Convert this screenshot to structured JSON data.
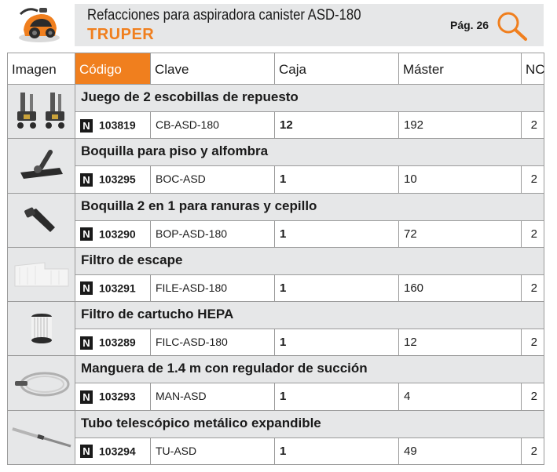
{
  "header": {
    "title": "Refacciones para aspiradora canister ASD-180",
    "brand": "TRUPER",
    "page": "Pág. 26",
    "search_icon": "magnifier-icon",
    "accent_color": "#f07f1e"
  },
  "columns": [
    "Imagen",
    "Código",
    "Clave",
    "Caja",
    "Máster",
    "NC"
  ],
  "products": [
    {
      "name": "Juego de 2 escobillas de repuesto",
      "badge": "N",
      "code": "103819",
      "clave": "CB-ASD-180",
      "caja": "12",
      "master": "192",
      "nc": "2",
      "image": "brushes-image"
    },
    {
      "name": "Boquilla para piso y alfombra",
      "badge": "N",
      "code": "103295",
      "clave": "BOC-ASD",
      "caja": "1",
      "master": "10",
      "nc": "2",
      "image": "floor-nozzle-image"
    },
    {
      "name": "Boquilla 2 en 1 para ranuras y cepillo",
      "badge": "N",
      "code": "103290",
      "clave": "BOP-ASD-180",
      "caja": "1",
      "master": "72",
      "nc": "2",
      "image": "crevice-nozzle-image"
    },
    {
      "name": "Filtro de escape",
      "badge": "N",
      "code": "103291",
      "clave": "FILE-ASD-180",
      "caja": "1",
      "master": "160",
      "nc": "2",
      "image": "exhaust-filter-image"
    },
    {
      "name": "Filtro de cartucho HEPA",
      "badge": "N",
      "code": "103289",
      "clave": "FILC-ASD-180",
      "caja": "1",
      "master": "12",
      "nc": "2",
      "image": "hepa-filter-image"
    },
    {
      "name": "Manguera de 1.4 m con regulador de succión",
      "badge": "N",
      "code": "103293",
      "clave": "MAN-ASD",
      "caja": "1",
      "master": "4",
      "nc": "2",
      "image": "hose-image"
    },
    {
      "name": "Tubo telescópico metálico expandible",
      "badge": "N",
      "code": "103294",
      "clave": "TU-ASD",
      "caja": "1",
      "master": "49",
      "nc": "2",
      "image": "telescopic-tube-image"
    }
  ]
}
